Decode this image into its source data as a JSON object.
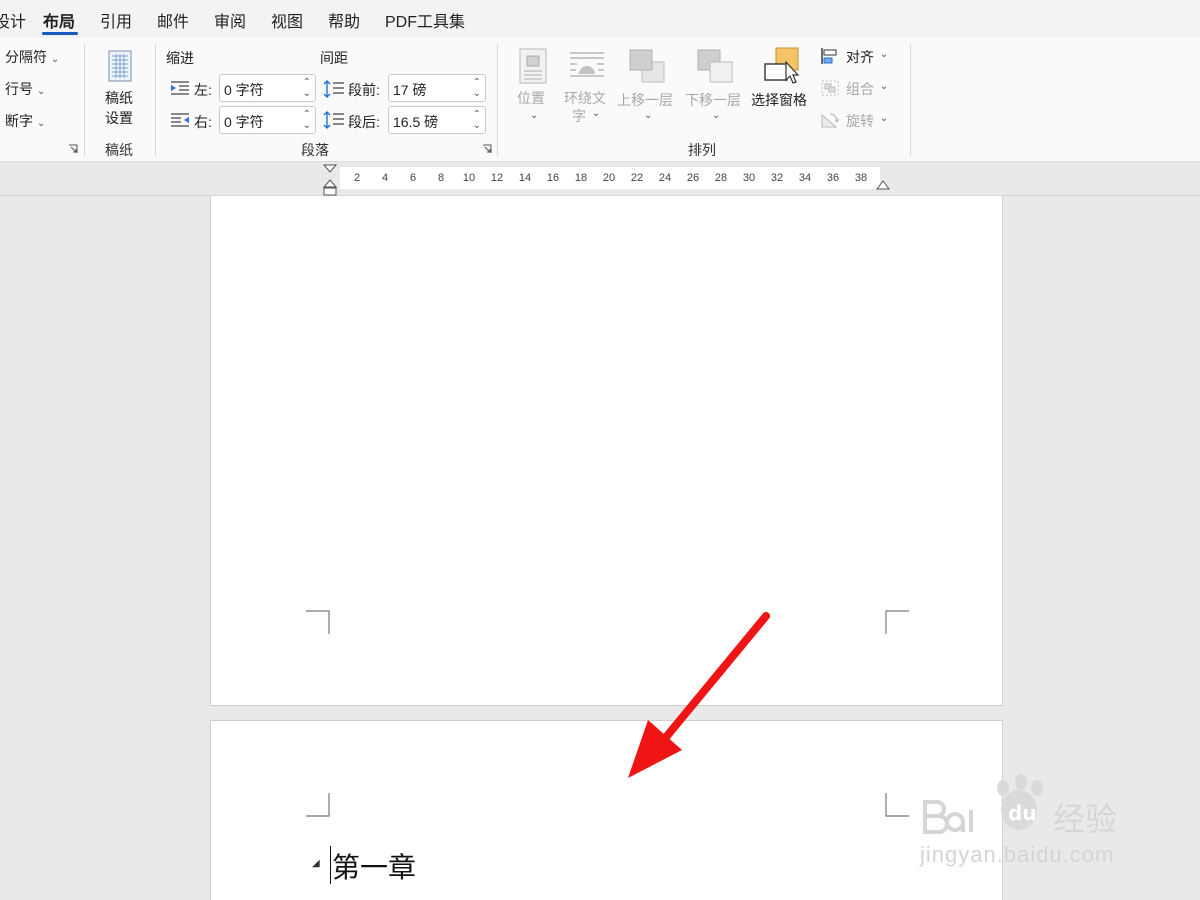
{
  "tabs": [
    {
      "label": "设计",
      "active": false
    },
    {
      "label": "布局",
      "active": true
    },
    {
      "label": "引用",
      "active": false
    },
    {
      "label": "邮件",
      "active": false
    },
    {
      "label": "审阅",
      "active": false
    },
    {
      "label": "视图",
      "active": false
    },
    {
      "label": "帮助",
      "active": false
    },
    {
      "label": "PDF工具集",
      "active": false
    }
  ],
  "page_setup": {
    "breaks": "分隔符",
    "line_numbers": "行号",
    "hyphenation": "断字"
  },
  "manuscript": {
    "button_line1": "稿纸",
    "button_line2": "设置",
    "group_label": "稿纸"
  },
  "paragraph": {
    "indent_header": "缩进",
    "spacing_header": "间距",
    "left_label": "左:",
    "left_value": "0 字符",
    "right_label": "右:",
    "right_value": "0 字符",
    "before_label": "段前:",
    "before_value": "17 磅",
    "after_label": "段后:",
    "after_value": "16.5 磅",
    "group_label": "段落"
  },
  "arrange": {
    "position": "位置",
    "wrap_text_line1": "环绕文",
    "wrap_text_line2": "字",
    "bring_forward": "上移一层",
    "send_backward": "下移一层",
    "selection_pane": "选择窗格",
    "align": "对齐",
    "group": "组合",
    "rotate": "旋转",
    "group_label": "排列"
  },
  "ruler": {
    "ticks": [
      "2",
      "4",
      "6",
      "8",
      "10",
      "12",
      "14",
      "16",
      "18",
      "20",
      "22",
      "24",
      "26",
      "28",
      "30",
      "32",
      "34",
      "36",
      "38"
    ]
  },
  "document": {
    "heading": "第一章"
  },
  "watermark": {
    "brand_text": "jingyan.baidu.com"
  },
  "colors": {
    "accent": "#185abd",
    "annotation_arrow": "#f01414",
    "selection_icon": "#f5c469"
  }
}
